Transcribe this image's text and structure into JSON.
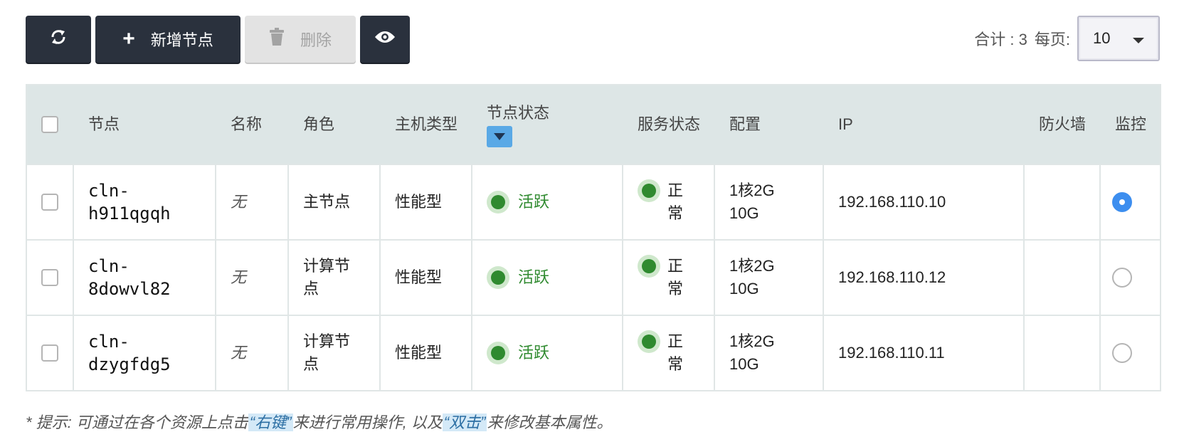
{
  "toolbar": {
    "refresh_icon": "refresh-icon",
    "add_label": "新增节点",
    "delete_label": "删除",
    "view_icon": "eye-icon"
  },
  "pager": {
    "total_label": "合计 : 3",
    "per_page_label": "每页:",
    "per_page_value": "10"
  },
  "table": {
    "columns": [
      "节点",
      "名称",
      "角色",
      "主机类型",
      "节点状态",
      "服务状态",
      "配置",
      "IP",
      "防火墙",
      "监控"
    ],
    "rows": [
      {
        "node_line1": "cln-",
        "node_line2": "h911qgqh",
        "name": "无",
        "role": "主节点",
        "host_type": "性能型",
        "node_status": "活跃",
        "service_status": "正常",
        "config_line1": "1核2G",
        "config_line2": "10G",
        "ip": "192.168.110.10",
        "firewall": "",
        "monitor_selected": true
      },
      {
        "node_line1": "cln-",
        "node_line2": "8dowvl82",
        "name": "无",
        "role": "计算节点",
        "host_type": "性能型",
        "node_status": "活跃",
        "service_status": "正常",
        "config_line1": "1核2G",
        "config_line2": "10G",
        "ip": "192.168.110.12",
        "firewall": "",
        "monitor_selected": false
      },
      {
        "node_line1": "cln-",
        "node_line2": "dzygfdg5",
        "name": "无",
        "role": "计算节点",
        "host_type": "性能型",
        "node_status": "活跃",
        "service_status": "正常",
        "config_line1": "1核2G",
        "config_line2": "10G",
        "ip": "192.168.110.11",
        "firewall": "",
        "monitor_selected": false
      }
    ]
  },
  "hint": {
    "prefix": "* 提示:  可通过在各个资源上点击",
    "right_click": "“右键”",
    "middle": "来进行常用操作, 以及",
    "double_click": "“双击”",
    "suffix": "来修改基本属性。"
  },
  "colors": {
    "toolbar_dark": "#2a313d",
    "header_bg": "#dde6e6",
    "status_green": "#2f8a2f",
    "radio_blue": "#3d8eef",
    "sort_blue": "#5aa9e6"
  }
}
